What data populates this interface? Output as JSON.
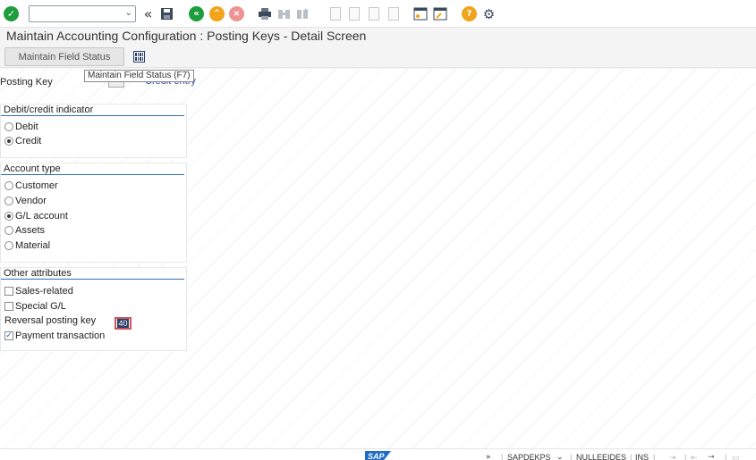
{
  "toolbar": {
    "command_field_value": "",
    "icons": [
      "enter-check-icon",
      "dropdown-arrow-icon",
      "double-chevron-left-icon",
      "save-icon",
      "back-icon",
      "exit-icon",
      "cancel-icon",
      "print-icon",
      "find-icon",
      "find-next-icon",
      "first-page-icon",
      "previous-page-icon",
      "next-page-icon",
      "last-page-icon",
      "create-session-icon",
      "shortcut-icon",
      "help-icon",
      "settings-icon"
    ]
  },
  "title": "Maintain Accounting Configuration : Posting Keys - Detail Screen",
  "app_toolbar": {
    "maintain_field_status_label": "Maintain Field Status",
    "tooltip": "Maintain Field Status   (F7)"
  },
  "header": {
    "posting_key_label": "Posting Key",
    "posting_key_value": "",
    "posting_key_desc": "Credit entry"
  },
  "debit_credit": {
    "title": "Debit/credit indicator",
    "options": [
      {
        "label": "Debit",
        "selected": false
      },
      {
        "label": "Credit",
        "selected": true
      }
    ]
  },
  "account_type": {
    "title": "Account type",
    "options": [
      {
        "label": "Customer",
        "selected": false
      },
      {
        "label": "Vendor",
        "selected": false
      },
      {
        "label": "G/L account",
        "selected": true
      },
      {
        "label": "Assets",
        "selected": false
      },
      {
        "label": "Material",
        "selected": false
      }
    ]
  },
  "other_attributes": {
    "title": "Other attributes",
    "sales_related": {
      "label": "Sales-related",
      "checked": false
    },
    "special_gl": {
      "label": "Special G/L",
      "checked": false
    },
    "reversal_posting_key": {
      "label": "Reversal posting key",
      "value": "40"
    },
    "payment_transaction": {
      "label": "Payment transaction",
      "checked": true
    }
  },
  "status_bar": {
    "logo": "SAP",
    "system": "SAPDEKPS",
    "client": "NULLEEIDES",
    "mode": "INS"
  },
  "colors": {
    "accent": "#2d6fb0",
    "ok_green": "#1e9d3c",
    "back_green": "#1e9d3c",
    "exit_orange": "#f0a51c",
    "cancel_red": "#e23a3a",
    "help_orange": "#f0a51c",
    "sap_blue": "#1d6cc7"
  }
}
